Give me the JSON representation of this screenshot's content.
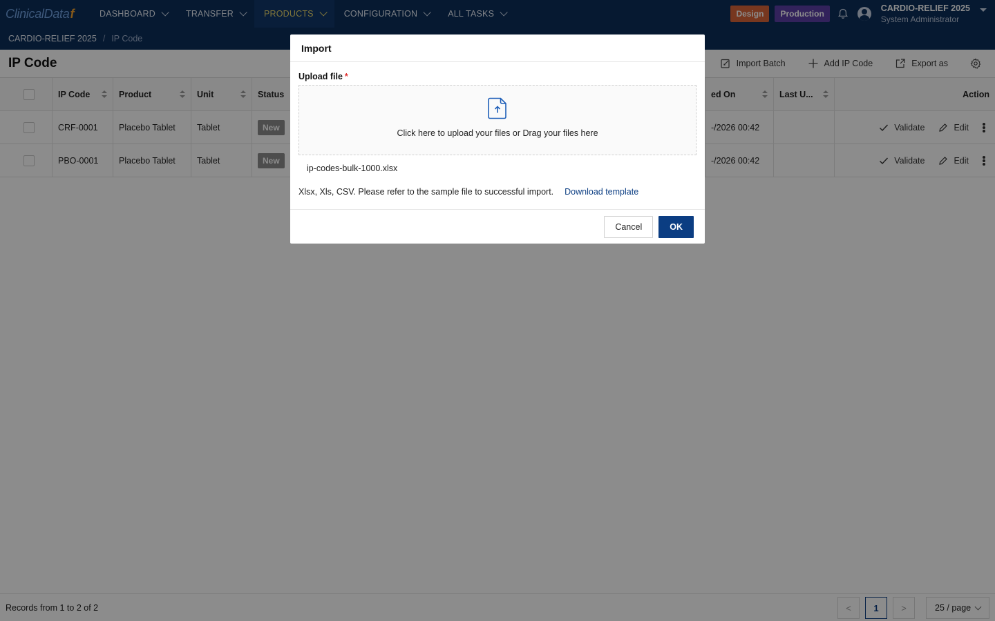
{
  "nav": {
    "logo_text": "ClinicalData",
    "logo_mark": "f",
    "items": [
      {
        "label": "DASHBOARD"
      },
      {
        "label": "TRANSFER"
      },
      {
        "label": "PRODUCTS"
      },
      {
        "label": "CONFIGURATION"
      },
      {
        "label": "ALL TASKS"
      }
    ],
    "active_item": "PRODUCTS",
    "design_label": "Design",
    "production_label": "Production",
    "study_name": "CARDIO-RELIEF 2025",
    "user_role": "System Administrator"
  },
  "breadcrumb": {
    "root": "CARDIO-RELIEF 2025",
    "separator": "/",
    "current": "IP Code"
  },
  "page": {
    "title": "IP Code",
    "toolbar": {
      "import_batch": "Import Batch",
      "add_ip_code": "Add IP Code",
      "export_as": "Export as"
    }
  },
  "table": {
    "columns": {
      "ip_code": "IP Code",
      "product": "Product",
      "unit": "Unit",
      "status": "Status",
      "created_on": "ed On",
      "last_updated": "Last U...",
      "action": "Action"
    },
    "rows": [
      {
        "ip_code": "CRF-0001",
        "product": "Placebo Tablet",
        "unit": "Tablet",
        "status": "New",
        "created_on": "-/2026 00:42",
        "last_updated": ""
      },
      {
        "ip_code": "PBO-0001",
        "product": "Placebo Tablet",
        "unit": "Tablet",
        "status": "New",
        "created_on": "-/2026 00:42",
        "last_updated": ""
      }
    ],
    "actions": {
      "validate": "Validate",
      "edit": "Edit"
    }
  },
  "footer": {
    "records": "Records from 1 to 2 of 2",
    "prev": "<",
    "current_page": "1",
    "next": ">",
    "page_size": "25 / page"
  },
  "modal": {
    "title": "Import",
    "upload_label": "Upload file",
    "required_mark": "*",
    "dropzone_text": "Click here to upload your files or Drag your files here",
    "file_name": "ip-codes-bulk-1000.xlsx",
    "hint": "Xlsx, Xls, CSV. Please refer to the sample file to successful import.",
    "download_link": "Download template",
    "cancel": "Cancel",
    "ok": "OK"
  },
  "colors": {
    "nav_bg": "#0b2e5a",
    "active_nav_text": "#e9d66b",
    "design_badge": "#d9643a",
    "production_badge": "#5b3fa6",
    "primary": "#0b3d82",
    "status_new": "#8c8c8c"
  }
}
